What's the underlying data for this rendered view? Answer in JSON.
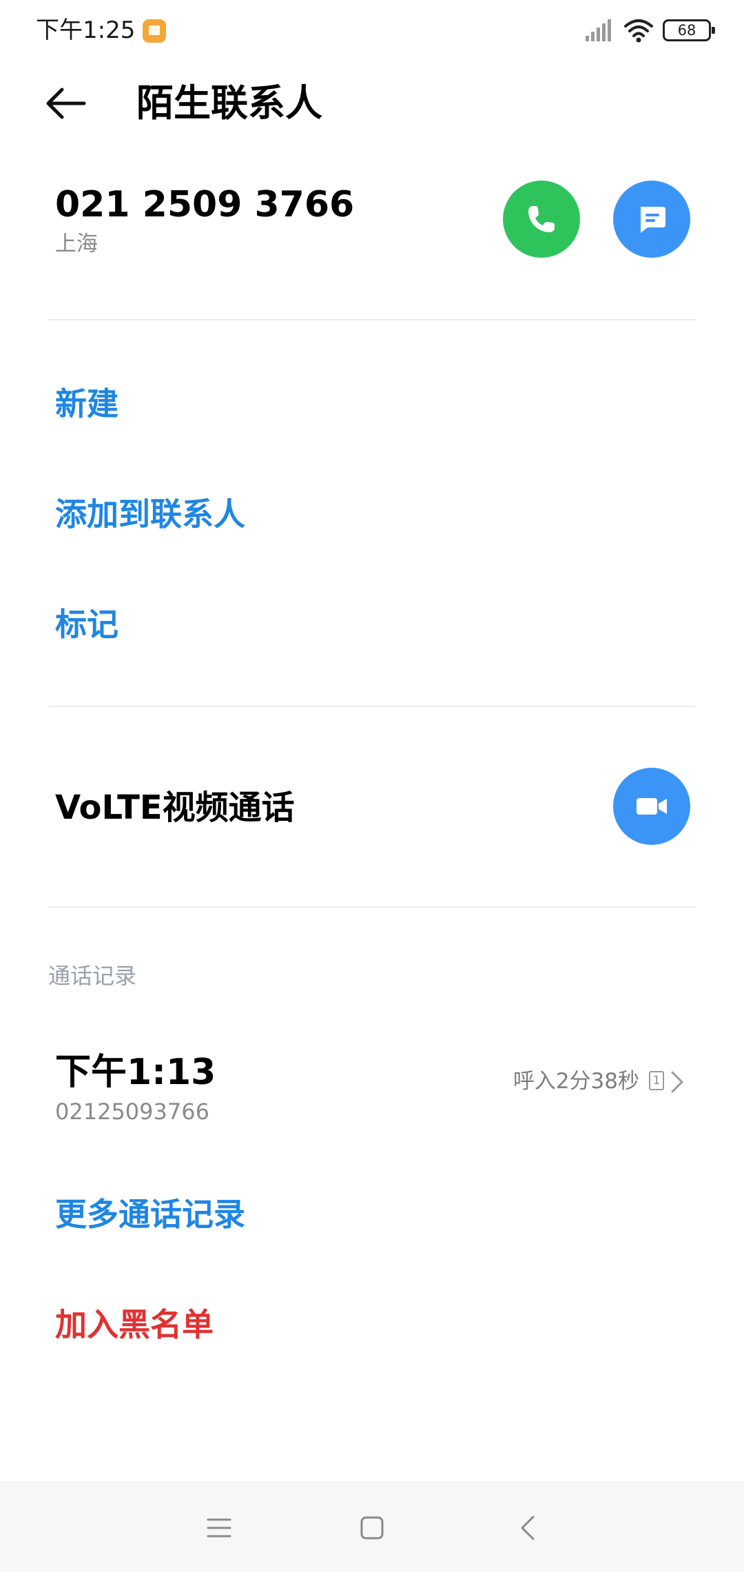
{
  "status_bar": {
    "time": "下午1:25",
    "battery_level": "68",
    "icons": [
      "app-notification-icon",
      "signal-icon",
      "wifi-icon",
      "battery-icon"
    ]
  },
  "header": {
    "back_icon": "back-arrow-icon",
    "title": "陌生联系人"
  },
  "caller": {
    "number": "021 2509 3766",
    "location": "上海",
    "call_icon": "phone-icon",
    "message_icon": "message-icon"
  },
  "actions": {
    "new": "新建",
    "add_to_contacts": "添加到联系人",
    "mark": "标记"
  },
  "volte": {
    "label": "VoLTE视频通话",
    "icon": "video-camera-icon"
  },
  "call_log": {
    "header": "通话记录",
    "entries": [
      {
        "time": "下午1:13",
        "number": "02125093766",
        "detail": "呼入2分38秒",
        "sim": "1"
      }
    ],
    "more_label": "更多通话记录"
  },
  "block_label": "加入黑名单",
  "nav_bar": {
    "icons": [
      "menu-icon",
      "home-icon",
      "back-icon"
    ]
  },
  "colors": {
    "accent_blue": "#1e86e3",
    "call_green": "#2fc35c",
    "button_blue": "#3b95f7",
    "danger_red": "#e03131"
  }
}
